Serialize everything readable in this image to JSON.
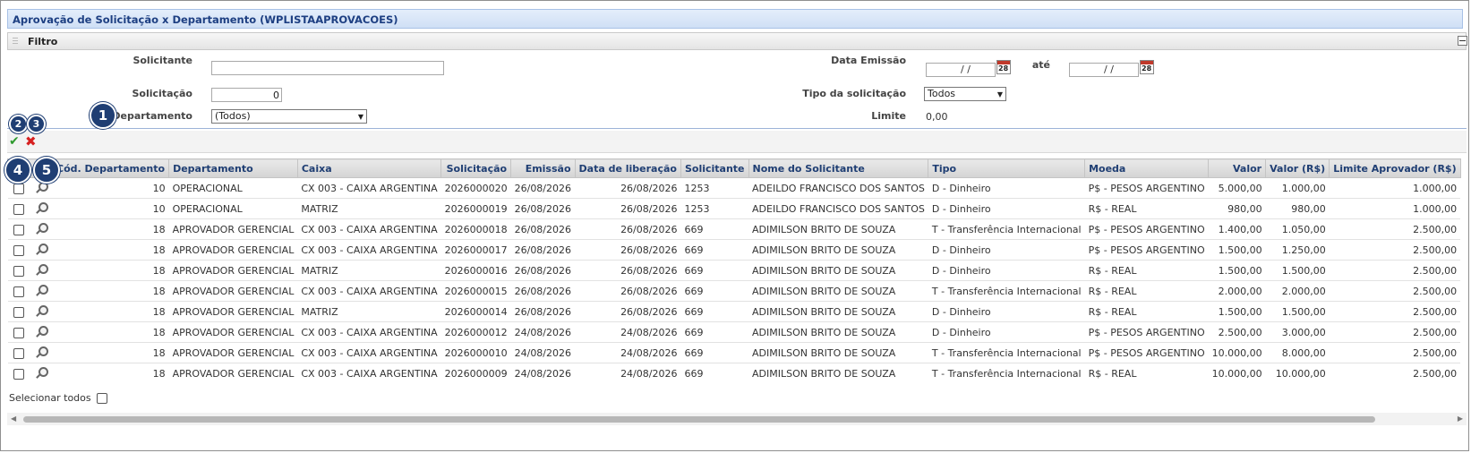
{
  "window": {
    "title": "Aprovação de Solicitação x Departamento (WPLISTAAPROVACOES)"
  },
  "filter": {
    "section_label": "Filtro",
    "solicitante_label": "Solicitante",
    "solicitante_value": "",
    "solicitacao_label": "Solicitação",
    "solicitacao_value": "0",
    "departamento_label": "Departamento",
    "departamento_value": "(Todos)",
    "data_emissao_label": "Data Emissão",
    "data_emissao_from": "/ /",
    "ate_label": "até",
    "data_emissao_to": "/ /",
    "calendar_day": "28",
    "tipo_label": "Tipo da solicitação",
    "tipo_value": "Todos",
    "limite_label": "Limite",
    "limite_value": "0,00"
  },
  "badges": [
    "1",
    "2",
    "3",
    "4",
    "5"
  ],
  "actions": {
    "approve_icon": "check-icon",
    "reject_icon": "x-icon",
    "approve_glyph": "✔",
    "reject_glyph": "✖"
  },
  "table": {
    "columns": [
      "Cód. Departamento",
      "Departamento",
      "Caixa",
      "Solicitação",
      "Emissão",
      "Data de liberação",
      "Solicitante",
      "Nome do Solicitante",
      "Tipo",
      "Moeda",
      "Valor",
      "Valor (R$)",
      "Limite Aprovador (R$)"
    ],
    "rows": [
      [
        "10",
        "OPERACIONAL",
        "CX 003 - CAIXA ARGENTINA",
        "2026000020",
        "26/08/2026",
        "26/08/2026",
        "1253",
        "ADEILDO FRANCISCO DOS SANTOS",
        "D - Dinheiro",
        "P$ - PESOS ARGENTINO",
        "5.000,00",
        "1.000,00",
        "1.000,00"
      ],
      [
        "10",
        "OPERACIONAL",
        "MATRIZ",
        "2026000019",
        "26/08/2026",
        "26/08/2026",
        "1253",
        "ADEILDO FRANCISCO DOS SANTOS",
        "D - Dinheiro",
        "R$ - REAL",
        "980,00",
        "980,00",
        "1.000,00"
      ],
      [
        "18",
        "APROVADOR GERENCIAL",
        "CX 003 - CAIXA ARGENTINA",
        "2026000018",
        "26/08/2026",
        "26/08/2026",
        "669",
        "ADIMILSON BRITO DE SOUZA",
        "T - Transferência Internacional",
        "P$ - PESOS ARGENTINO",
        "1.400,00",
        "1.050,00",
        "2.500,00"
      ],
      [
        "18",
        "APROVADOR GERENCIAL",
        "CX 003 - CAIXA ARGENTINA",
        "2026000017",
        "26/08/2026",
        "26/08/2026",
        "669",
        "ADIMILSON BRITO DE SOUZA",
        "D - Dinheiro",
        "P$ - PESOS ARGENTINO",
        "1.500,00",
        "1.250,00",
        "2.500,00"
      ],
      [
        "18",
        "APROVADOR GERENCIAL",
        "MATRIZ",
        "2026000016",
        "26/08/2026",
        "26/08/2026",
        "669",
        "ADIMILSON BRITO DE SOUZA",
        "D - Dinheiro",
        "R$ - REAL",
        "1.500,00",
        "1.500,00",
        "2.500,00"
      ],
      [
        "18",
        "APROVADOR GERENCIAL",
        "CX 003 - CAIXA ARGENTINA",
        "2026000015",
        "26/08/2026",
        "26/08/2026",
        "669",
        "ADIMILSON BRITO DE SOUZA",
        "T - Transferência Internacional",
        "R$ - REAL",
        "2.000,00",
        "2.000,00",
        "2.500,00"
      ],
      [
        "18",
        "APROVADOR GERENCIAL",
        "MATRIZ",
        "2026000014",
        "26/08/2026",
        "26/08/2026",
        "669",
        "ADIMILSON BRITO DE SOUZA",
        "D - Dinheiro",
        "R$ - REAL",
        "1.500,00",
        "1.500,00",
        "2.500,00"
      ],
      [
        "18",
        "APROVADOR GERENCIAL",
        "CX 003 - CAIXA ARGENTINA",
        "2026000012",
        "24/08/2026",
        "24/08/2026",
        "669",
        "ADIMILSON BRITO DE SOUZA",
        "D - Dinheiro",
        "P$ - PESOS ARGENTINO",
        "2.500,00",
        "3.000,00",
        "2.500,00"
      ],
      [
        "18",
        "APROVADOR GERENCIAL",
        "CX 003 - CAIXA ARGENTINA",
        "2026000010",
        "24/08/2026",
        "24/08/2026",
        "669",
        "ADIMILSON BRITO DE SOUZA",
        "T - Transferência Internacional",
        "P$ - PESOS ARGENTINO",
        "10.000,00",
        "8.000,00",
        "2.500,00"
      ],
      [
        "18",
        "APROVADOR GERENCIAL",
        "CX 003 - CAIXA ARGENTINA",
        "2026000009",
        "24/08/2026",
        "24/08/2026",
        "669",
        "ADIMILSON BRITO DE SOUZA",
        "T - Transferência Internacional",
        "R$ - REAL",
        "10.000,00",
        "10.000,00",
        "2.500,00"
      ]
    ]
  },
  "footer": {
    "select_all_label": "Selecionar todos"
  }
}
